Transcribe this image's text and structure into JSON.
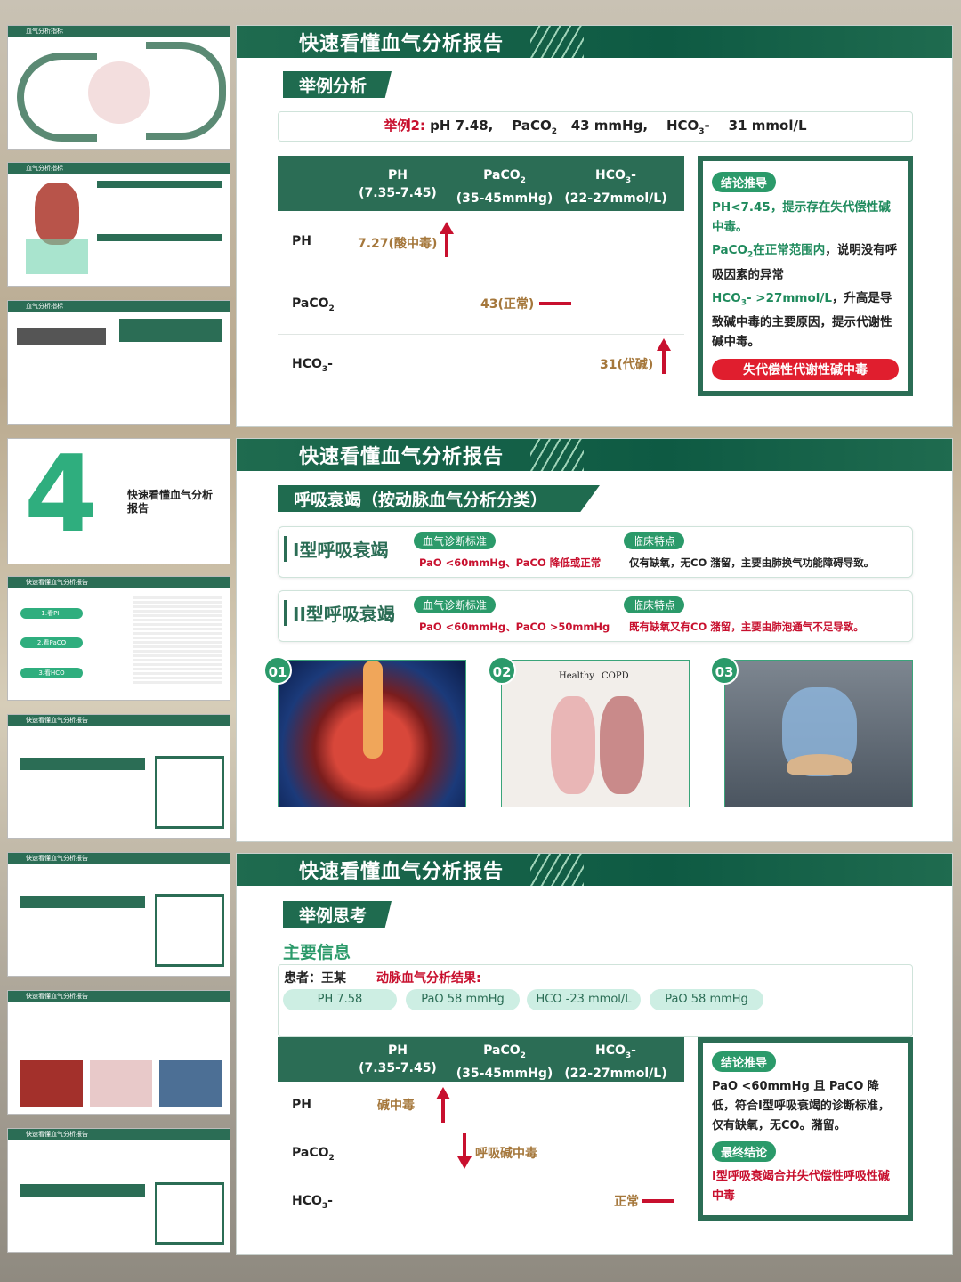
{
  "slide_title": "快速看懂血气分析报告",
  "slide1": {
    "sub": "举例分析",
    "example": {
      "label": "举例2:",
      "ph": "pH 7.48,",
      "paco2": "PaCO",
      "paco2_unit": "43 mmHg,",
      "hco3": "HCO",
      "hco3_unit": "31 mmol/L"
    },
    "table": {
      "headers": [
        {
          "name": "PH",
          "range": "(7.35-7.45)"
        },
        {
          "name": "PaCO",
          "range": "(35-45mmHg)"
        },
        {
          "name": "HCO",
          "range": "(22-27mmol/L)"
        }
      ],
      "rows": [
        {
          "label": "PH",
          "value": "7.27(酸中毒)"
        },
        {
          "label": "PaCO",
          "value": "43(正常)"
        },
        {
          "label": "HCO",
          "value": "31(代碱)"
        }
      ]
    },
    "conclusion": {
      "tag": "结论推导",
      "p1": "PH<7.45，提示存在失代偿性碱中毒。",
      "p2a": "PaCO",
      "p2b": "在正常范围内",
      "p2c": "，说明没有呼吸因素的异常",
      "p3a": "HCO",
      "p3b": "- >27mmol/L",
      "p3c": "，升高是导致碱中毒的主要原因，提示代谢性碱中毒。",
      "result": "失代偿性代谢性碱中毒"
    }
  },
  "slide2": {
    "sub": "呼吸衰竭（按动脉血气分析分类）",
    "types": [
      {
        "title": "I型呼吸衰竭",
        "tag1": "血气诊断标准",
        "crit": "PaO <60mmHg、PaCO 降低或正常",
        "tag2": "临床特点",
        "feat": "仅有缺氧，无CO 潴留，主要由肺换气功能障碍导致。"
      },
      {
        "title": "II型呼吸衰竭",
        "tag1": "血气诊断标准",
        "crit": "PaO <60mmHg、PaCO >50mmHg",
        "tag2": "临床特点",
        "feat": "既有缺氧又有CO 潴留，主要由肺泡通气不足导致。"
      }
    ],
    "images": [
      {
        "num": "01"
      },
      {
        "num": "02",
        "t1": "Healthy",
        "t2": "COPD"
      },
      {
        "num": "03"
      }
    ]
  },
  "slide3": {
    "sub": "举例思考",
    "main_info": "主要信息",
    "patient_label": "患者：王某",
    "result_label": "动脉血气分析结果:",
    "tags": [
      "PH 7.58",
      "PaO 58 mmHg",
      "HCO -23 mmol/L",
      "PaO 58 mmHg"
    ],
    "rows": [
      {
        "label": "PH",
        "value": "碱中毒"
      },
      {
        "label": "PaCO",
        "value": "呼吸碱中毒"
      },
      {
        "label": "HCO",
        "value": "正常"
      }
    ],
    "conclusion": {
      "tag": "结论推导",
      "text": "PaO <60mmHg 且 PaCO 降低，符合I型呼吸衰竭的诊断标准，仅有缺氧，无CO。潴留。",
      "tag2": "最终结论",
      "final": "I型呼吸衰竭合并失代偿性呼吸性碱中毒"
    }
  },
  "thumbs": {
    "t1": "血气分析指标",
    "t2": "血气分析指标",
    "t3": "血气分析指标",
    "t4num": "4",
    "t4title": "快速看懂血气分析报告",
    "t5": "快速看懂血气分析报告",
    "t5b": "1.看PH",
    "t5c": "2.看PaCO",
    "t5d": "3.看HCO"
  },
  "colors": {
    "primary": "#2b6d55",
    "accent": "#2b9a6a",
    "alert": "#c8102e",
    "value": "#a5773b"
  }
}
